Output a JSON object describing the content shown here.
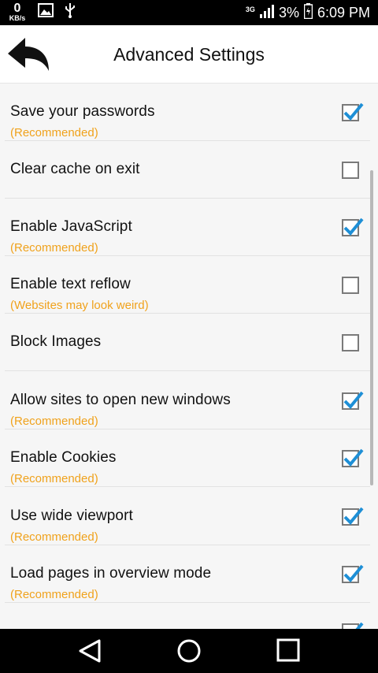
{
  "status": {
    "speed_value": "0",
    "speed_unit": "KB/s",
    "network": "3G",
    "battery": "3%",
    "time": "6:09 PM"
  },
  "header": {
    "title": "Advanced Settings"
  },
  "colors": {
    "accent": "#1e8fd6",
    "subtitle": "#f0a21c"
  },
  "settings": [
    {
      "label": "Save your passwords",
      "sub": "(Recommended)",
      "checked": true
    },
    {
      "label": "Clear cache on exit",
      "sub": "",
      "checked": false
    },
    {
      "label": "Enable JavaScript",
      "sub": "(Recommended)",
      "checked": true
    },
    {
      "label": "Enable text reflow",
      "sub": "(Websites may look weird)",
      "checked": false
    },
    {
      "label": "Block Images",
      "sub": "",
      "checked": false
    },
    {
      "label": "Allow sites to open new windows",
      "sub": "(Recommended)",
      "checked": true
    },
    {
      "label": "Enable Cookies",
      "sub": "(Recommended)",
      "checked": true
    },
    {
      "label": "Use wide viewport",
      "sub": "(Recommended)",
      "checked": true
    },
    {
      "label": "Load pages in overview mode",
      "sub": "(Recommended)",
      "checked": true
    },
    {
      "label": "",
      "sub": "",
      "checked": true
    }
  ]
}
